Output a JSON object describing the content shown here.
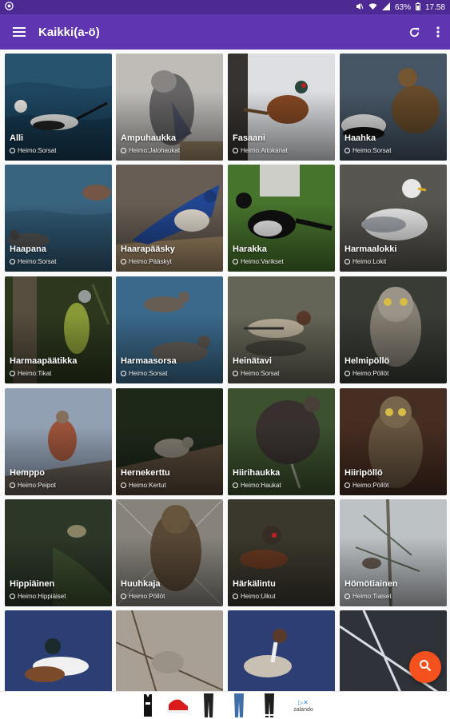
{
  "status_bar": {
    "battery": "63%",
    "time": "17.58"
  },
  "app_bar": {
    "title": "Kaikki(a-ö)",
    "menu_icon": "menu-icon",
    "refresh_icon": "refresh-icon",
    "more_icon": "more-vert-icon"
  },
  "colors": {
    "status_bar": "#4d2a93",
    "app_bar": "#5f35b1",
    "fab": "#f4511e"
  },
  "birds": [
    {
      "name": "Alli",
      "family": "Heimo:Sorsat"
    },
    {
      "name": "Ampuhaukka",
      "family": "Heimo:Jalohaukat"
    },
    {
      "name": "Fasaani",
      "family": "Heimo:Aitokanat"
    },
    {
      "name": "Haahka",
      "family": "Heimo:Sorsat"
    },
    {
      "name": "Haapana",
      "family": "Heimo:Sorsat"
    },
    {
      "name": "Haarapääsky",
      "family": "Heimo:Pääskyt"
    },
    {
      "name": "Harakka",
      "family": "Heimo:Varikset"
    },
    {
      "name": "Harmaalokki",
      "family": "Heimo:Lokit"
    },
    {
      "name": "Harmaapäätikka",
      "family": "Heimo:Tikat"
    },
    {
      "name": "Harmaasorsa",
      "family": "Heimo:Sorsat"
    },
    {
      "name": "Heinätavi",
      "family": "Heimo:Sorsat"
    },
    {
      "name": "Helmipöllö",
      "family": "Heimo:Pöllöt"
    },
    {
      "name": "Hemppo",
      "family": "Heimo:Peipot"
    },
    {
      "name": "Herne­kerttu",
      "family": "Heimo:Kertut"
    },
    {
      "name": "Hiirihaukka",
      "family": "Heimo:Haukat"
    },
    {
      "name": "Hiiripöllö",
      "family": "Heimo:Pöllöt"
    },
    {
      "name": "Hippiäinen",
      "family": "Heimo:Hippiäiset"
    },
    {
      "name": "Huuhkaja",
      "family": "Heimo:Pöllöt"
    },
    {
      "name": "Härkälintu",
      "family": "Heimo:Uikut"
    },
    {
      "name": "Hömötiainen",
      "family": "Heimo:Tiaiset"
    },
    {
      "name": "",
      "family": ""
    },
    {
      "name": "",
      "family": ""
    },
    {
      "name": "",
      "family": ""
    },
    {
      "name": "",
      "family": ""
    }
  ],
  "fab": {
    "icon": "search-icon"
  },
  "ad": {
    "brand": "zalando",
    "items": [
      "black-tanktop",
      "red-sneakers",
      "black-pants",
      "blue-jeans",
      "black-joggers"
    ]
  }
}
